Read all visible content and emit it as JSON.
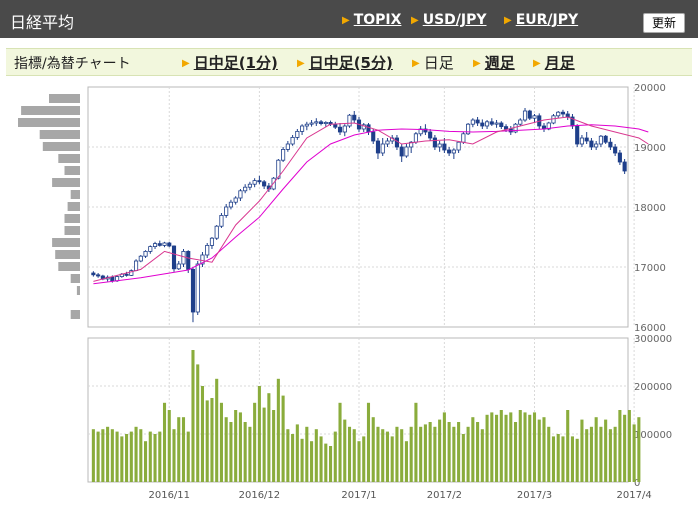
{
  "header": {
    "title": "日経平均",
    "links": [
      "TOPIX",
      "USD/JPY",
      "EUR/JPY"
    ],
    "refresh_label": "更新"
  },
  "subnav": {
    "label": "指標/為替チャート",
    "tabs": [
      {
        "label": "日中足(1分)",
        "current": false
      },
      {
        "label": "日中足(5分)",
        "current": false
      },
      {
        "label": "日足",
        "current": true
      },
      {
        "label": "週足",
        "current": false
      },
      {
        "label": "月足",
        "current": false
      }
    ]
  },
  "colors": {
    "candle_up": "#ffffff",
    "candle_down": "#1e3f8a",
    "candle_outline": "#1e3f8a",
    "ma_short": "#d9368f",
    "ma_long": "#e000d0",
    "volume_bar": "#8aac3c",
    "profile_bar": "#a7a7a7",
    "grid": "#d9d9d9"
  },
  "chart_data": {
    "type": "candlestick",
    "price_axis": {
      "min": 16000,
      "max": 20000,
      "ticks": [
        20000,
        19000,
        18000,
        17000,
        16000
      ]
    },
    "volume_axis": {
      "min": 0,
      "max": 300000,
      "ticks": [
        300000,
        200000,
        100000,
        0
      ]
    },
    "x_ticks": [
      {
        "label": "2016/11",
        "index": 16
      },
      {
        "label": "2016/12",
        "index": 35
      },
      {
        "label": "2017/1",
        "index": 56
      },
      {
        "label": "2017/2",
        "index": 74
      },
      {
        "label": "2017/3",
        "index": 93
      },
      {
        "label": "2017/4",
        "index": 114
      }
    ],
    "candles": [
      [
        16900,
        16930,
        16840,
        16870
      ],
      [
        16870,
        16900,
        16820,
        16850
      ],
      [
        16850,
        16870,
        16780,
        16800
      ],
      [
        16800,
        16860,
        16760,
        16830
      ],
      [
        16830,
        16860,
        16740,
        16770
      ],
      [
        16770,
        16860,
        16750,
        16840
      ],
      [
        16840,
        16900,
        16820,
        16880
      ],
      [
        16880,
        16920,
        16840,
        16860
      ],
      [
        16860,
        16960,
        16850,
        16940
      ],
      [
        16940,
        17130,
        16930,
        17100
      ],
      [
        17100,
        17200,
        17080,
        17180
      ],
      [
        17180,
        17280,
        17150,
        17260
      ],
      [
        17260,
        17360,
        17220,
        17340
      ],
      [
        17340,
        17420,
        17300,
        17390
      ],
      [
        17390,
        17440,
        17340,
        17360
      ],
      [
        17360,
        17420,
        17330,
        17400
      ],
      [
        17400,
        17420,
        17330,
        17350
      ],
      [
        17350,
        17360,
        16920,
        16970
      ],
      [
        16970,
        17100,
        16950,
        17050
      ],
      [
        17050,
        17300,
        17000,
        17260
      ],
      [
        17260,
        17280,
        16900,
        16960
      ],
      [
        16960,
        17000,
        16080,
        16250
      ],
      [
        16250,
        17100,
        16200,
        17050
      ],
      [
        17050,
        17250,
        17000,
        17200
      ],
      [
        17200,
        17400,
        17150,
        17360
      ],
      [
        17360,
        17500,
        17300,
        17480
      ],
      [
        17480,
        17700,
        17450,
        17680
      ],
      [
        17680,
        17900,
        17650,
        17860
      ],
      [
        17860,
        18050,
        17820,
        18000
      ],
      [
        18000,
        18120,
        17960,
        18080
      ],
      [
        18080,
        18180,
        18040,
        18150
      ],
      [
        18150,
        18300,
        18100,
        18270
      ],
      [
        18270,
        18380,
        18230,
        18330
      ],
      [
        18330,
        18420,
        18280,
        18380
      ],
      [
        18380,
        18480,
        18330,
        18440
      ],
      [
        18440,
        18520,
        18380,
        18420
      ],
      [
        18420,
        18450,
        18300,
        18350
      ],
      [
        18350,
        18400,
        18250,
        18300
      ],
      [
        18300,
        18500,
        18280,
        18480
      ],
      [
        18480,
        18800,
        18460,
        18780
      ],
      [
        18780,
        19000,
        18750,
        18960
      ],
      [
        18960,
        19100,
        18920,
        19050
      ],
      [
        19050,
        19200,
        19020,
        19160
      ],
      [
        19160,
        19300,
        19120,
        19260
      ],
      [
        19260,
        19380,
        19200,
        19350
      ],
      [
        19350,
        19420,
        19280,
        19380
      ],
      [
        19380,
        19450,
        19340,
        19400
      ],
      [
        19400,
        19480,
        19350,
        19420
      ],
      [
        19420,
        19450,
        19360,
        19390
      ],
      [
        19390,
        19430,
        19340,
        19410
      ],
      [
        19410,
        19440,
        19350,
        19380
      ],
      [
        19380,
        19420,
        19300,
        19330
      ],
      [
        19330,
        19400,
        19200,
        19250
      ],
      [
        19250,
        19380,
        19180,
        19350
      ],
      [
        19350,
        19550,
        19320,
        19530
      ],
      [
        19530,
        19600,
        19400,
        19450
      ],
      [
        19450,
        19500,
        19250,
        19300
      ],
      [
        19300,
        19400,
        19250,
        19370
      ],
      [
        19370,
        19400,
        19200,
        19250
      ],
      [
        19250,
        19300,
        19050,
        19100
      ],
      [
        19100,
        19150,
        18800,
        18900
      ],
      [
        18900,
        19150,
        18850,
        19050
      ],
      [
        19050,
        19150,
        19000,
        19100
      ],
      [
        19100,
        19200,
        19050,
        19150
      ],
      [
        19150,
        19200,
        18950,
        19000
      ],
      [
        19000,
        19050,
        18750,
        18850
      ],
      [
        18850,
        19050,
        18820,
        19000
      ],
      [
        19000,
        19100,
        18900,
        19080
      ],
      [
        19080,
        19250,
        19050,
        19220
      ],
      [
        19220,
        19350,
        19180,
        19300
      ],
      [
        19300,
        19380,
        19200,
        19250
      ],
      [
        19250,
        19300,
        19100,
        19150
      ],
      [
        19150,
        19200,
        18950,
        19000
      ],
      [
        19000,
        19100,
        18920,
        19050
      ],
      [
        19050,
        19150,
        18900,
        18950
      ],
      [
        18950,
        19000,
        18850,
        18900
      ],
      [
        18900,
        18980,
        18800,
        18950
      ],
      [
        18950,
        19100,
        18900,
        19080
      ],
      [
        19080,
        19250,
        19050,
        19220
      ],
      [
        19220,
        19400,
        19200,
        19380
      ],
      [
        19380,
        19480,
        19330,
        19450
      ],
      [
        19450,
        19500,
        19350,
        19400
      ],
      [
        19400,
        19460,
        19300,
        19350
      ],
      [
        19350,
        19450,
        19300,
        19420
      ],
      [
        19420,
        19480,
        19350,
        19380
      ],
      [
        19380,
        19450,
        19320,
        19400
      ],
      [
        19400,
        19430,
        19300,
        19340
      ],
      [
        19340,
        19380,
        19250,
        19300
      ],
      [
        19300,
        19350,
        19200,
        19250
      ],
      [
        19250,
        19400,
        19230,
        19380
      ],
      [
        19380,
        19480,
        19350,
        19450
      ],
      [
        19450,
        19650,
        19420,
        19600
      ],
      [
        19600,
        19620,
        19450,
        19480
      ],
      [
        19480,
        19550,
        19400,
        19520
      ],
      [
        19520,
        19560,
        19300,
        19350
      ],
      [
        19350,
        19400,
        19250,
        19300
      ],
      [
        19300,
        19420,
        19280,
        19400
      ],
      [
        19400,
        19550,
        19380,
        19520
      ],
      [
        19520,
        19600,
        19480,
        19580
      ],
      [
        19580,
        19620,
        19500,
        19550
      ],
      [
        19550,
        19600,
        19450,
        19500
      ],
      [
        19500,
        19550,
        19300,
        19350
      ],
      [
        19350,
        19380,
        19000,
        19050
      ],
      [
        19050,
        19200,
        19000,
        19150
      ],
      [
        19150,
        19250,
        19050,
        19100
      ],
      [
        19100,
        19150,
        18950,
        19000
      ],
      [
        19000,
        19100,
        18950,
        19050
      ],
      [
        19050,
        19200,
        19000,
        19180
      ],
      [
        19180,
        19200,
        19050,
        19080
      ],
      [
        19080,
        19150,
        18950,
        19000
      ],
      [
        19000,
        19050,
        18850,
        18900
      ],
      [
        18900,
        18950,
        18700,
        18750
      ],
      [
        18750,
        18800,
        18550,
        18600
      ]
    ],
    "volume": [
      110000,
      105000,
      110000,
      115000,
      110000,
      105000,
      95000,
      100000,
      105000,
      115000,
      110000,
      85000,
      105000,
      100000,
      105000,
      165000,
      150000,
      110000,
      135000,
      135000,
      105000,
      275000,
      245000,
      200000,
      170000,
      175000,
      215000,
      165000,
      135000,
      125000,
      150000,
      145000,
      125000,
      115000,
      165000,
      200000,
      155000,
      185000,
      150000,
      215000,
      180000,
      110000,
      100000,
      120000,
      90000,
      115000,
      85000,
      110000,
      95000,
      80000,
      75000,
      105000,
      165000,
      130000,
      115000,
      110000,
      85000,
      95000,
      165000,
      135000,
      115000,
      110000,
      105000,
      95000,
      115000,
      110000,
      85000,
      115000,
      165000,
      115000,
      120000,
      125000,
      115000,
      130000,
      145000,
      125000,
      115000,
      125000,
      100000,
      115000,
      135000,
      125000,
      110000,
      140000,
      145000,
      140000,
      150000,
      140000,
      145000,
      125000,
      150000,
      145000,
      140000,
      145000,
      130000,
      135000,
      115000,
      95000,
      100000,
      95000,
      150000,
      95000,
      90000,
      130000,
      110000,
      115000,
      135000,
      115000,
      130000,
      110000,
      115000,
      150000,
      140000,
      150000,
      120000,
      135000
    ],
    "ma_short": [
      [
        0,
        16760
      ],
      [
        10,
        16960
      ],
      [
        15,
        17260
      ],
      [
        20,
        17150
      ],
      [
        25,
        17080
      ],
      [
        30,
        17700
      ],
      [
        35,
        18100
      ],
      [
        40,
        18600
      ],
      [
        45,
        19150
      ],
      [
        50,
        19380
      ],
      [
        55,
        19400
      ],
      [
        60,
        19280
      ],
      [
        65,
        19050
      ],
      [
        70,
        19100
      ],
      [
        75,
        19120
      ],
      [
        80,
        19050
      ],
      [
        85,
        19250
      ],
      [
        90,
        19350
      ],
      [
        95,
        19450
      ],
      [
        100,
        19500
      ],
      [
        105,
        19350
      ],
      [
        110,
        19250
      ],
      [
        115,
        19150
      ],
      [
        117,
        19050
      ]
    ],
    "ma_long": [
      [
        0,
        16720
      ],
      [
        10,
        16820
      ],
      [
        20,
        16950
      ],
      [
        25,
        17150
      ],
      [
        30,
        17500
      ],
      [
        35,
        17830
      ],
      [
        40,
        18300
      ],
      [
        45,
        18750
      ],
      [
        50,
        19050
      ],
      [
        55,
        19200
      ],
      [
        60,
        19280
      ],
      [
        65,
        19300
      ],
      [
        70,
        19290
      ],
      [
        75,
        19260
      ],
      [
        80,
        19250
      ],
      [
        85,
        19260
      ],
      [
        90,
        19280
      ],
      [
        95,
        19300
      ],
      [
        100,
        19350
      ],
      [
        105,
        19370
      ],
      [
        110,
        19350
      ],
      [
        115,
        19300
      ],
      [
        117,
        19250
      ]
    ],
    "price_volume_profile": [
      [
        19800,
        0.5
      ],
      [
        19600,
        0.95
      ],
      [
        19400,
        1.0
      ],
      [
        19200,
        0.65
      ],
      [
        19000,
        0.6
      ],
      [
        18800,
        0.35
      ],
      [
        18600,
        0.25
      ],
      [
        18400,
        0.45
      ],
      [
        18200,
        0.15
      ],
      [
        18000,
        0.2
      ],
      [
        17800,
        0.25
      ],
      [
        17600,
        0.25
      ],
      [
        17400,
        0.45
      ],
      [
        17200,
        0.4
      ],
      [
        17000,
        0.35
      ],
      [
        16800,
        0.15
      ],
      [
        16600,
        0.05
      ],
      [
        16200,
        0.15
      ]
    ]
  }
}
